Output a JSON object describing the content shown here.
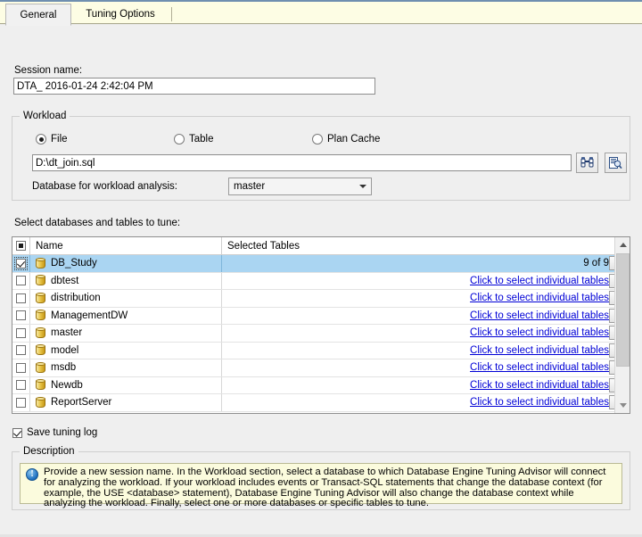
{
  "tabs": [
    {
      "label": "General",
      "active": true
    },
    {
      "label": "Tuning Options",
      "active": false
    }
  ],
  "session": {
    "label": "Session name:",
    "value": "DTA_ 2016-01-24 2:42:04 PM",
    "placeholder": ""
  },
  "workload": {
    "title": "Workload",
    "radios": [
      {
        "label": "File",
        "selected": true
      },
      {
        "label": "Table",
        "selected": false
      },
      {
        "label": "Plan Cache",
        "selected": false
      }
    ],
    "file_value": "D:\\dt_join.sql",
    "file_placeholder": "",
    "browse_icon": "binoculars-icon",
    "advanced_icon": "document-properties-icon",
    "db_analysis_label": "Database for workload analysis:",
    "db_analysis_value": "master"
  },
  "grid": {
    "caption": "Select databases and tables to tune:",
    "columns": [
      "Name",
      "Selected Tables"
    ],
    "header_checkbox_state": "indeterminate",
    "link_text": "Click to select individual tables",
    "rows": [
      {
        "name": "DB_Study",
        "checked": true,
        "selected": true,
        "selected_tables": "9 of 9",
        "is_link": false
      },
      {
        "name": "dbtest",
        "checked": false,
        "selected": false,
        "selected_tables": "Click to select individual tables",
        "is_link": true
      },
      {
        "name": "distribution",
        "checked": false,
        "selected": false,
        "selected_tables": "Click to select individual tables",
        "is_link": true
      },
      {
        "name": "ManagementDW",
        "checked": false,
        "selected": false,
        "selected_tables": "Click to select individual tables",
        "is_link": true
      },
      {
        "name": "master",
        "checked": false,
        "selected": false,
        "selected_tables": "Click to select individual tables",
        "is_link": true
      },
      {
        "name": "model",
        "checked": false,
        "selected": false,
        "selected_tables": "Click to select individual tables",
        "is_link": true
      },
      {
        "name": "msdb",
        "checked": false,
        "selected": false,
        "selected_tables": "Click to select individual tables",
        "is_link": true
      },
      {
        "name": "Newdb",
        "checked": false,
        "selected": false,
        "selected_tables": "Click to select individual tables",
        "is_link": true
      },
      {
        "name": "ReportServer",
        "checked": false,
        "selected": false,
        "selected_tables": "Click to select individual tables",
        "is_link": true
      }
    ]
  },
  "save_tuning_log": {
    "label": "Save tuning log",
    "checked": true
  },
  "description": {
    "title": "Description",
    "icon": "info-icon",
    "text": "Provide a new session name. In the Workload section, select a database to which Database Engine Tuning Advisor will connect for analyzing the workload. If your workload includes events or Transact-SQL statements that change the database context (for example, the USE <database> statement), Database Engine Tuning Advisor will also change the database context while analyzing the workload. Finally, select one or more databases or specific tables to tune."
  },
  "colors": {
    "selection": "#aad5f2",
    "link": "#0000d6",
    "tabstrip": "#fdfde4",
    "description_bg": "#fbfbdd",
    "window_bg": "#efefef"
  }
}
